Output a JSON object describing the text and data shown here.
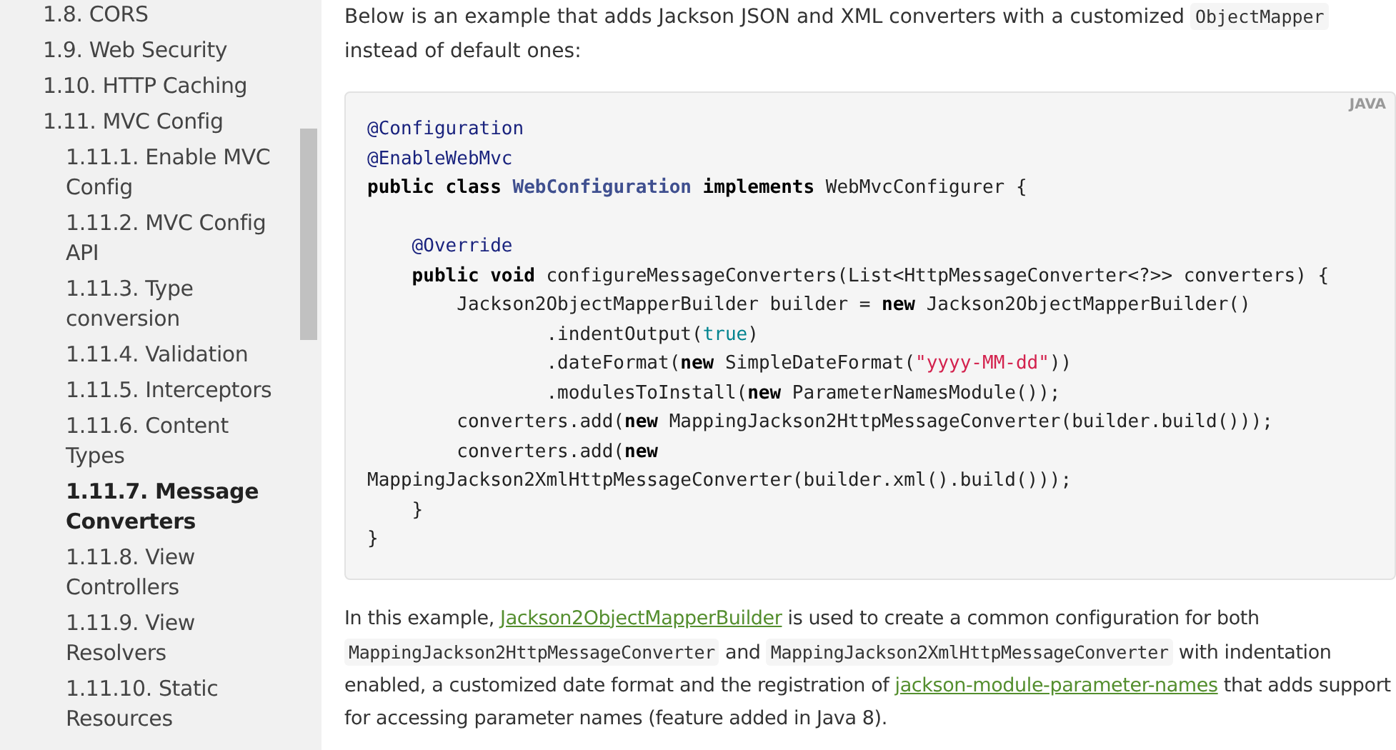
{
  "sidebar": {
    "items": [
      {
        "label": "1.8. CORS",
        "selected": false
      },
      {
        "label": "1.9. Web Security",
        "selected": false
      },
      {
        "label": "1.10. HTTP Caching",
        "selected": false
      },
      {
        "label": "1.11. MVC Config",
        "selected": false,
        "children": [
          {
            "label": "1.11.1. Enable MVC Config",
            "selected": false
          },
          {
            "label": "1.11.2. MVC Config API",
            "selected": false
          },
          {
            "label": "1.11.3. Type conversion",
            "selected": false
          },
          {
            "label": "1.11.4. Validation",
            "selected": false
          },
          {
            "label": "1.11.5. Interceptors",
            "selected": false
          },
          {
            "label": "1.11.6. Content Types",
            "selected": false
          },
          {
            "label": "1.11.7. Message Converters",
            "selected": true
          },
          {
            "label": "1.11.8. View Controllers",
            "selected": false
          },
          {
            "label": "1.11.9. View Resolvers",
            "selected": false
          },
          {
            "label": "1.11.10. Static Resources",
            "selected": false
          }
        ]
      }
    ]
  },
  "intro": [
    {
      "kind": "text",
      "text": "Below is an example that adds Jackson JSON and XML converters with a customized "
    },
    {
      "kind": "code",
      "text": "ObjectMapper"
    },
    {
      "kind": "text",
      "text": " instead of default ones:"
    }
  ],
  "code_block": {
    "language": "JAVA",
    "lines": [
      {
        "kind": "code",
        "tokens": [
          {
            "kind": "annotation",
            "text": "@Configuration"
          }
        ]
      },
      {
        "kind": "code",
        "tokens": [
          {
            "kind": "annotation",
            "text": "@EnableWebMvc"
          }
        ]
      },
      {
        "kind": "code",
        "tokens": [
          {
            "kind": "keyword",
            "text": "public class "
          },
          {
            "kind": "type",
            "text": "WebConfiguration"
          },
          {
            "kind": "keyword",
            "text": " implements "
          },
          {
            "kind": "plain",
            "text": "WebMvcConfigurer {"
          }
        ]
      },
      {
        "kind": "blank"
      },
      {
        "kind": "code",
        "tokens": [
          {
            "kind": "annotation",
            "text": "    @Override"
          }
        ]
      },
      {
        "kind": "code",
        "tokens": [
          {
            "kind": "keyword",
            "text": "    public void "
          },
          {
            "kind": "plain",
            "text": "configureMessageConverters(List<HttpMessageConverter<?>> converters) {"
          }
        ]
      },
      {
        "kind": "code",
        "tokens": [
          {
            "kind": "plain",
            "text": "        Jackson2ObjectMapperBuilder builder = "
          },
          {
            "kind": "keyword",
            "text": "new "
          },
          {
            "kind": "plain",
            "text": "Jackson2ObjectMapperBuilder()"
          }
        ]
      },
      {
        "kind": "code",
        "tokens": [
          {
            "kind": "plain",
            "text": "                .indentOutput("
          },
          {
            "kind": "literal",
            "text": "true"
          },
          {
            "kind": "plain",
            "text": ")"
          }
        ]
      },
      {
        "kind": "code",
        "tokens": [
          {
            "kind": "plain",
            "text": "                .dateFormat("
          },
          {
            "kind": "keyword",
            "text": "new "
          },
          {
            "kind": "plain",
            "text": "SimpleDateFormat("
          },
          {
            "kind": "string",
            "text": "\"yyyy-MM-dd\""
          },
          {
            "kind": "plain",
            "text": "))"
          }
        ]
      },
      {
        "kind": "code",
        "tokens": [
          {
            "kind": "plain",
            "text": "                .modulesToInstall("
          },
          {
            "kind": "keyword",
            "text": "new "
          },
          {
            "kind": "plain",
            "text": "ParameterNamesModule());"
          }
        ]
      },
      {
        "kind": "code",
        "tokens": [
          {
            "kind": "plain",
            "text": "        converters.add("
          },
          {
            "kind": "keyword",
            "text": "new "
          },
          {
            "kind": "plain",
            "text": "MappingJackson2HttpMessageConverter(builder.build()));"
          }
        ]
      },
      {
        "kind": "code",
        "tokens": [
          {
            "kind": "plain",
            "text": "        converters.add("
          },
          {
            "kind": "keyword",
            "text": "new"
          }
        ]
      },
      {
        "kind": "code",
        "tokens": [
          {
            "kind": "plain",
            "text": "MappingJackson2XmlHttpMessageConverter(builder.xml().build()));"
          }
        ]
      },
      {
        "kind": "code",
        "tokens": [
          {
            "kind": "plain",
            "text": "    }"
          }
        ]
      },
      {
        "kind": "code",
        "tokens": [
          {
            "kind": "plain",
            "text": "}"
          }
        ]
      }
    ]
  },
  "description": [
    {
      "kind": "text",
      "text": "In this example, "
    },
    {
      "kind": "link",
      "text": "Jackson2ObjectMapperBuilder"
    },
    {
      "kind": "text",
      "text": " is used to create a common configuration for both "
    },
    {
      "kind": "code",
      "text": "MappingJackson2HttpMessageConverter"
    },
    {
      "kind": "text",
      "text": " and "
    },
    {
      "kind": "code",
      "text": "MappingJackson2XmlHttpMessageConverter"
    },
    {
      "kind": "text",
      "text": " with indentation enabled, a customized date format and the registration of "
    },
    {
      "kind": "link",
      "text": "jackson-module-parameter-names"
    },
    {
      "kind": "text",
      "text": " that adds support for accessing parameter names (feature added in Java 8)."
    }
  ]
}
